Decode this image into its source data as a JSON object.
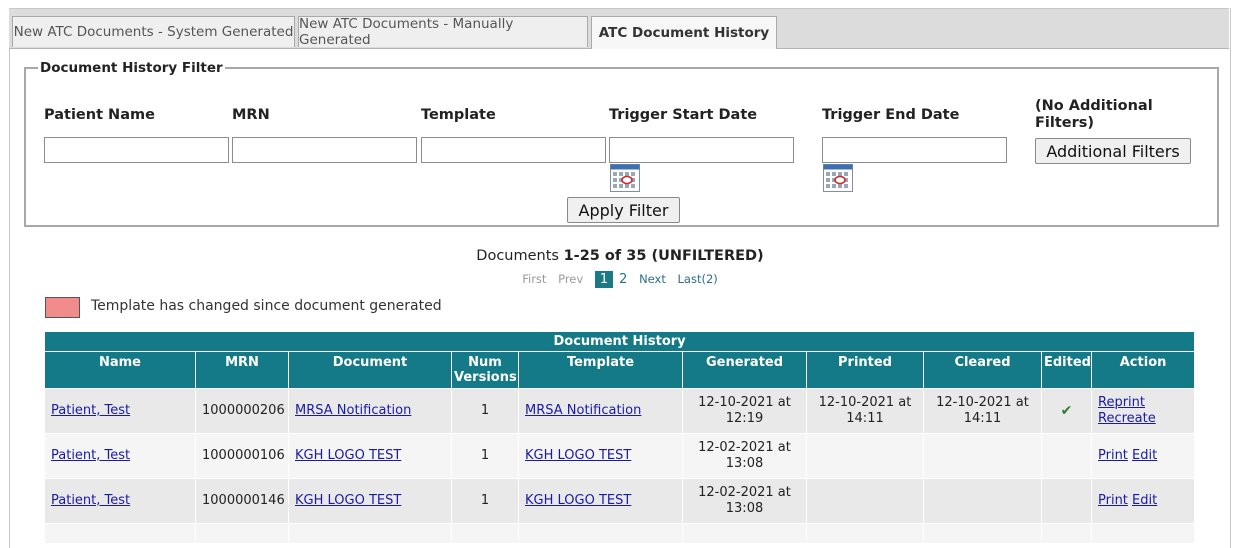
{
  "tabs": [
    {
      "label": "New ATC Documents - System Generated"
    },
    {
      "label": "New ATC Documents - Manually Generated"
    },
    {
      "label": "ATC Document History"
    }
  ],
  "filter": {
    "legend": "Document History Filter",
    "patient_name_label": "Patient Name",
    "mrn_label": "MRN",
    "template_label": "Template",
    "trigger_start_label": "Trigger Start Date",
    "trigger_end_label": "Trigger End Date",
    "no_additional_line1": "(No Additional",
    "no_additional_line2": "Filters)",
    "additional_filters_button": "Additional Filters",
    "apply_button": "Apply Filter",
    "patient_name_value": "",
    "mrn_value": "",
    "template_value": "",
    "trigger_start_value": "",
    "trigger_end_value": ""
  },
  "summary": {
    "prefix": "Documents",
    "range": "1-25 of 35 (UNFILTERED)"
  },
  "pager": {
    "first": "First",
    "prev": "Prev",
    "current": "1",
    "page2": "2",
    "next": "Next",
    "last": "Last(2)"
  },
  "legend_text": "Template has changed since document generated",
  "table": {
    "caption": "Document History",
    "headers": {
      "name": "Name",
      "mrn": "MRN",
      "document": "Document",
      "num_versions": "Num Versions",
      "template": "Template",
      "generated": "Generated",
      "printed": "Printed",
      "cleared": "Cleared",
      "edited": "Edited",
      "action": "Action"
    },
    "rows": [
      {
        "name": "Patient, Test",
        "mrn": "1000000206",
        "document": "MRSA Notification",
        "num_versions": "1",
        "template": "MRSA Notification",
        "generated": "12-10-2021 at 12:19",
        "printed": "12-10-2021 at 14:11",
        "cleared": "12-10-2021 at 14:11",
        "edited": "✔",
        "action1": "Reprint",
        "action2": "Recreate"
      },
      {
        "name": "Patient, Test",
        "mrn": "1000000106",
        "document": "KGH LOGO TEST",
        "num_versions": "1",
        "template": "KGH LOGO TEST",
        "generated": "12-02-2021 at 13:08",
        "printed": "",
        "cleared": "",
        "edited": "",
        "action1": "Print",
        "action2": "Edit"
      },
      {
        "name": "Patient, Test",
        "mrn": "1000000146",
        "document": "KGH LOGO TEST",
        "num_versions": "1",
        "template": "KGH LOGO TEST",
        "generated": "12-02-2021 at 13:08",
        "printed": "",
        "cleared": "",
        "edited": "",
        "action1": "Print",
        "action2": "Edit"
      }
    ]
  },
  "colors": {
    "header_teal": "#157a87",
    "changed_template": "#f28c8c",
    "link": "#1a1aa6"
  }
}
